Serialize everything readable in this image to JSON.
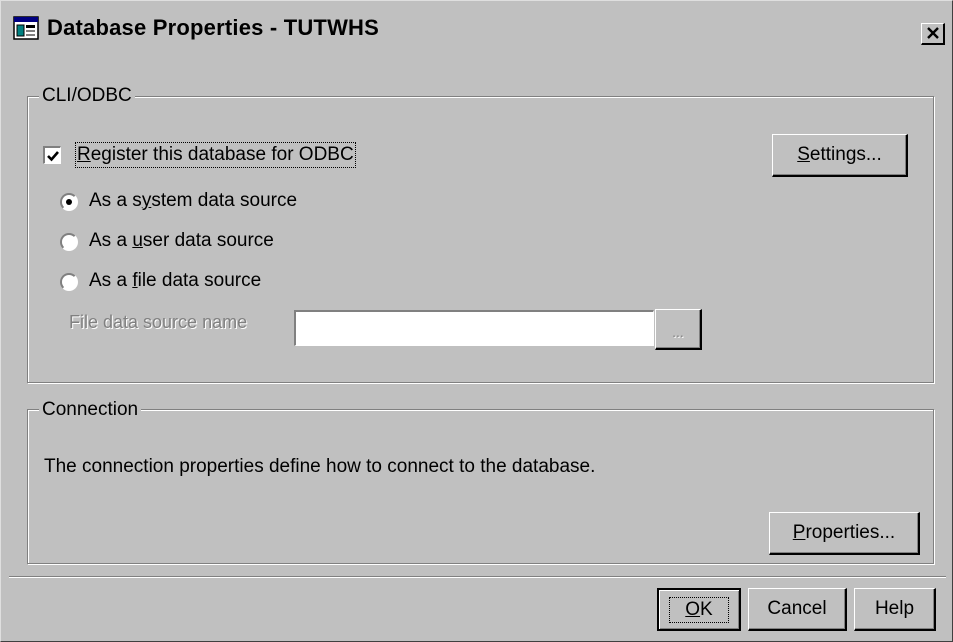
{
  "window": {
    "title": "Database Properties - TUTWHS",
    "close_label": "×"
  },
  "cli_odbc": {
    "legend": "CLI/ODBC",
    "register": {
      "checked": true,
      "label_prefix": "",
      "label_mnemonic": "R",
      "label_rest": "egister this database for ODBC"
    },
    "settings_button": {
      "mnemonic": "S",
      "rest": "ettings..."
    },
    "radios": [
      {
        "selected": true,
        "pre": "As a s",
        "mnemonic": "y",
        "post": "stem data source"
      },
      {
        "selected": false,
        "pre": "As a ",
        "mnemonic": "u",
        "post": "ser data source"
      },
      {
        "selected": false,
        "pre": "As a ",
        "mnemonic": "f",
        "post": "ile data source"
      }
    ],
    "file_dsn": {
      "label": "File data source name",
      "value": "",
      "browse_label": "..."
    }
  },
  "connection": {
    "legend": "Connection",
    "description": "The connection properties define how to connect to the database.",
    "properties_button": {
      "mnemonic": "P",
      "rest": "roperties..."
    }
  },
  "footer": {
    "ok": {
      "mnemonic": "O",
      "rest": "K"
    },
    "cancel": "Cancel",
    "help": "Help"
  },
  "icons": [
    "database-window-icon",
    "close-icon",
    "checkmark-icon"
  ]
}
